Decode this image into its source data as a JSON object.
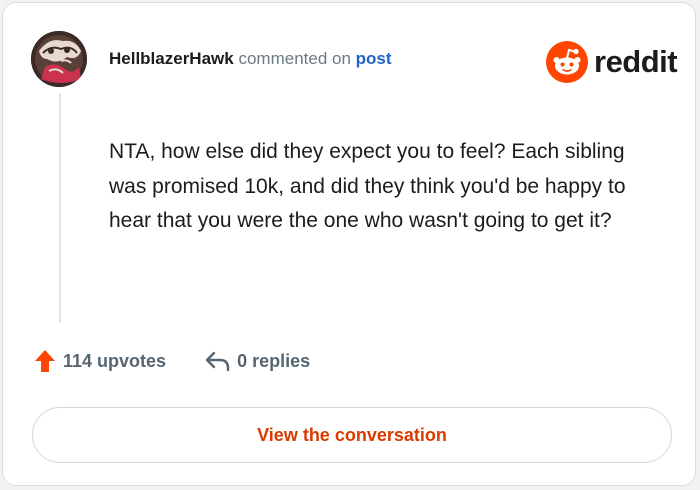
{
  "comment": {
    "username": "HellblazerHawk",
    "action_text": "commented on",
    "post_link_text": "post",
    "body": "NTA, how else did they expect you to feel? Each sibling was promised 10k, and did they think you'd be happy to hear that you were the one who wasn't going to get it?",
    "avatar_icon": "user-avatar-image"
  },
  "brand": {
    "name": "reddit",
    "icon": "reddit-snoo-icon",
    "color": "#ff4500"
  },
  "stats": {
    "upvotes_label": "114 upvotes",
    "upvote_icon": "upvote-arrow-icon",
    "upvote_color": "#ff4500",
    "replies_label": "0 replies",
    "reply_icon": "reply-arrow-icon"
  },
  "actions": {
    "view_conversation_label": "View the conversation",
    "accent_color": "#d93a00"
  }
}
